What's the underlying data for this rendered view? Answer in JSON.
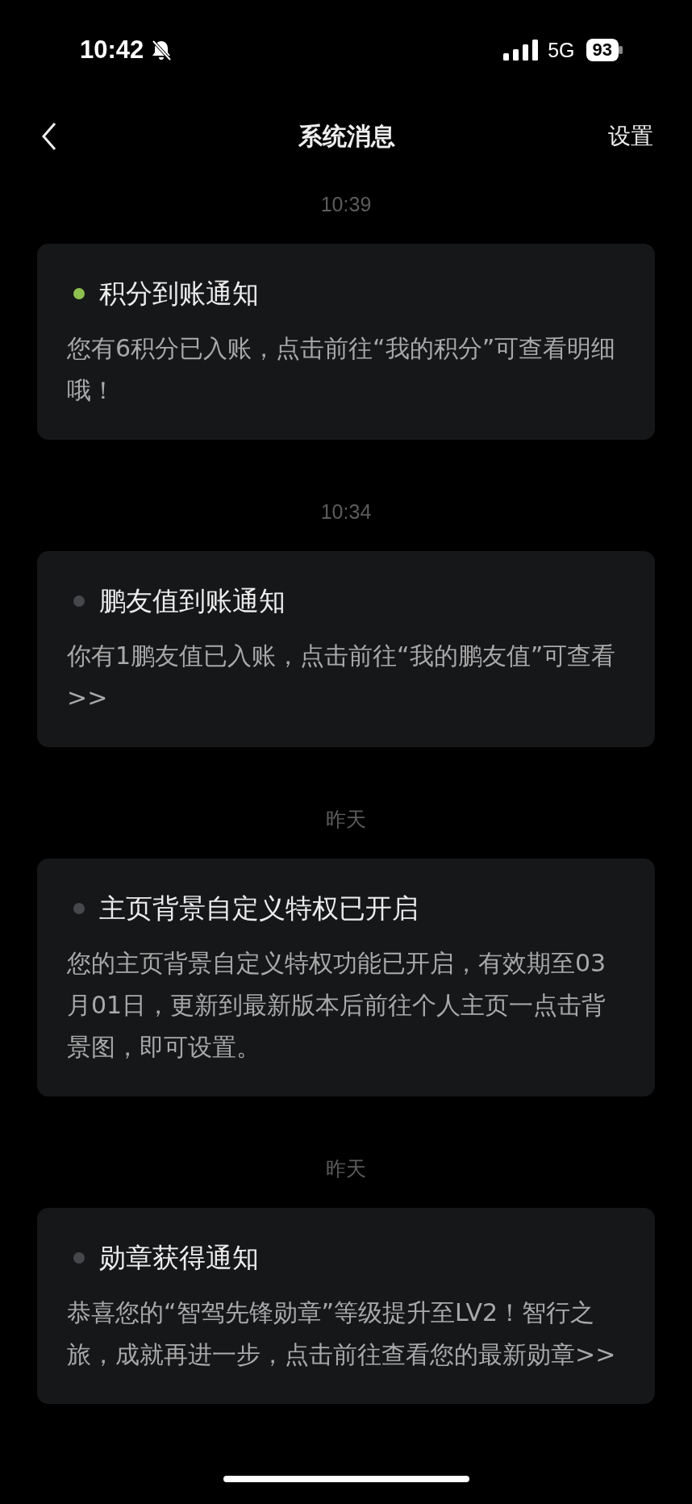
{
  "status_bar": {
    "time": "10:42",
    "silent": true,
    "network": "5G",
    "battery": "93"
  },
  "nav": {
    "title": "系统消息",
    "action": "设置"
  },
  "messages": [
    {
      "time": "10:39",
      "title": "积分到账通知",
      "body": "您有6积分已入账，点击前往“我的积分”可查看明细哦！",
      "unread": true
    },
    {
      "time": "10:34",
      "title": "鹏友值到账通知",
      "body": "你有1鹏友值已入账，点击前往“我的鹏友值”可查看>>",
      "unread": false
    },
    {
      "time": "昨天",
      "title": "主页背景自定义特权已开启",
      "body": "您的主页背景自定义特权功能已开启，有效期至03月01日，更新到最新版本后前往个人主页一点击背景图，即可设置。",
      "unread": false
    },
    {
      "time": "昨天",
      "title": "勋章获得通知",
      "body": "恭喜您的“智驾先锋勋章”等级提升至LV2！智行之旅，成就再进一步，点击前往查看您的最新勋章>>",
      "unread": false
    }
  ]
}
